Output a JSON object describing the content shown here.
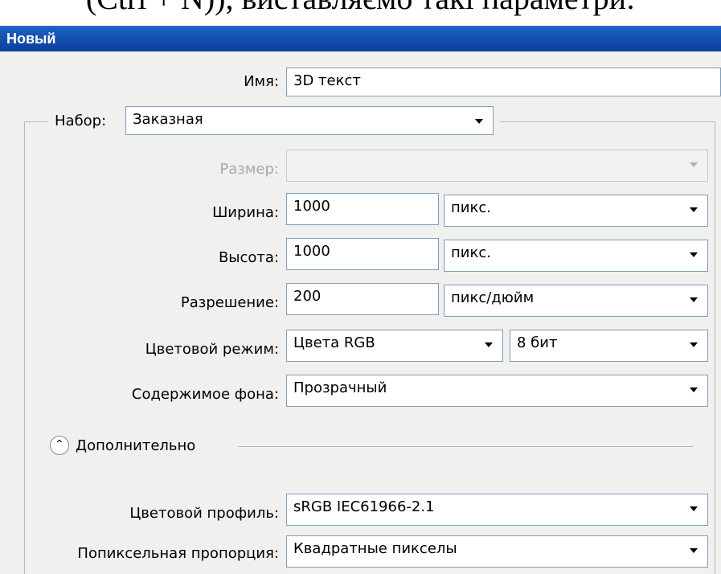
{
  "caption": "(Ctrl + N)), виставляємо такі параметри:",
  "window": {
    "title": "Новый"
  },
  "form": {
    "name_label": "Имя:",
    "name_value": "3D текст",
    "preset_label": "Набор:",
    "preset_value": "Заказная",
    "size_label": "Размер:",
    "size_value": "",
    "width_label": "Ширина:",
    "width_value": "1000",
    "width_unit": "пикс.",
    "height_label": "Высота:",
    "height_value": "1000",
    "height_unit": "пикс.",
    "resolution_label": "Разрешение:",
    "resolution_value": "200",
    "resolution_unit": "пикс/дюйм",
    "color_mode_label": "Цветовой режим:",
    "color_mode_value": "Цвета RGB",
    "bit_depth_value": "8 бит",
    "background_label": "Содержимое фона:",
    "background_value": "Прозрачный",
    "advanced_label": "Дополнительно",
    "advanced_icon": "double-chevron-up-icon",
    "profile_label": "Цветовой профиль:",
    "profile_value": "sRGB IEC61966-2.1",
    "pixel_aspect_label": "Попиксельная пропорция:",
    "pixel_aspect_value": "Квадратные пикселы"
  }
}
